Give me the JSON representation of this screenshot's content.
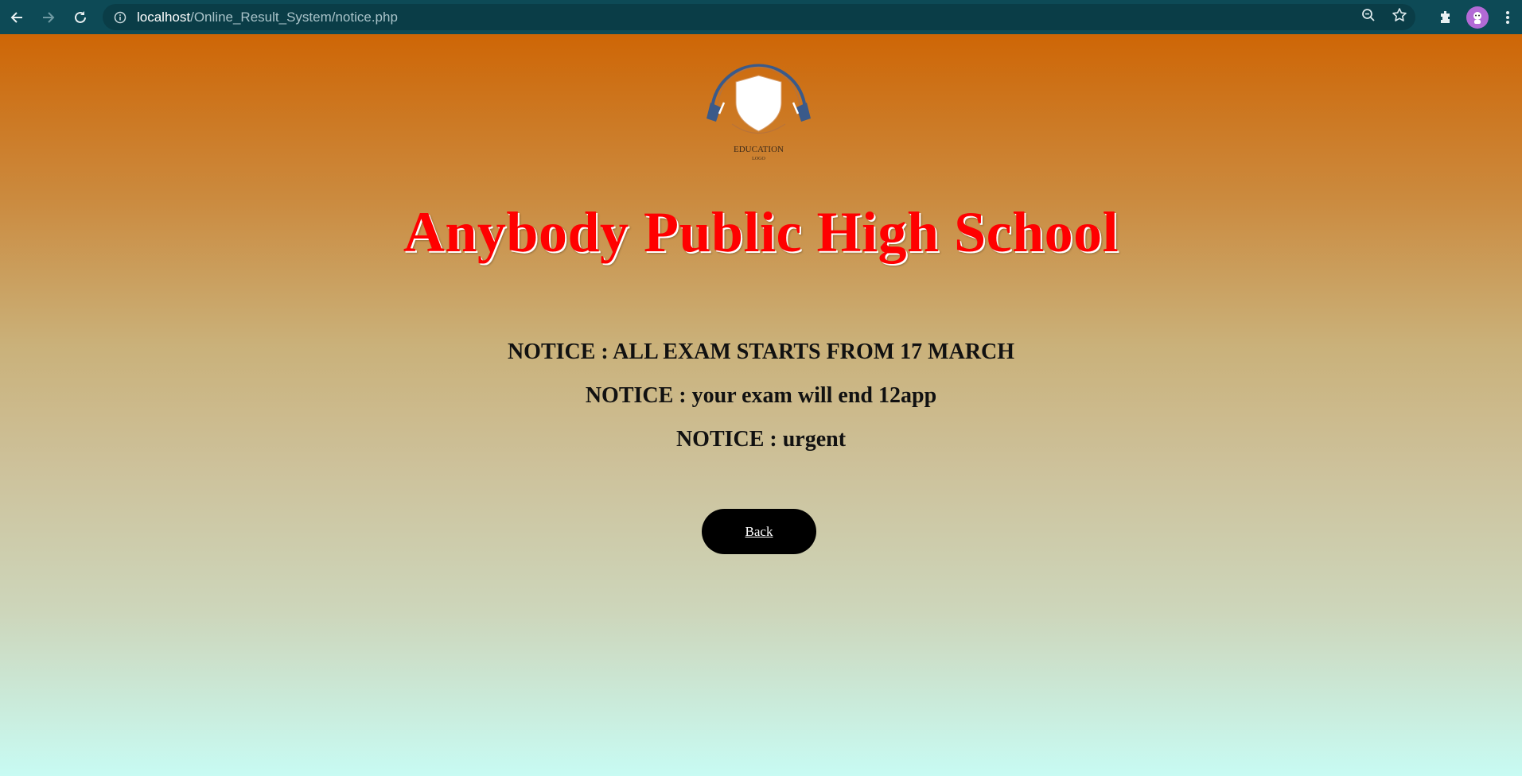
{
  "browser": {
    "url_host": "localhost",
    "url_path": "/Online_Result_System/notice.php"
  },
  "logo": {
    "line1": "EDUCATION",
    "line2": "LOGO"
  },
  "school_title": "Anybody Public High School",
  "notices": [
    "NOTICE : ALL EXAM STARTS FROM 17 MARCH",
    "NOTICE : your exam will end 12app",
    "NOTICE : urgent"
  ],
  "back_label": "Back",
  "colors": {
    "chrome": "#0d4a56",
    "title": "#ff0000",
    "button": "#000000"
  }
}
